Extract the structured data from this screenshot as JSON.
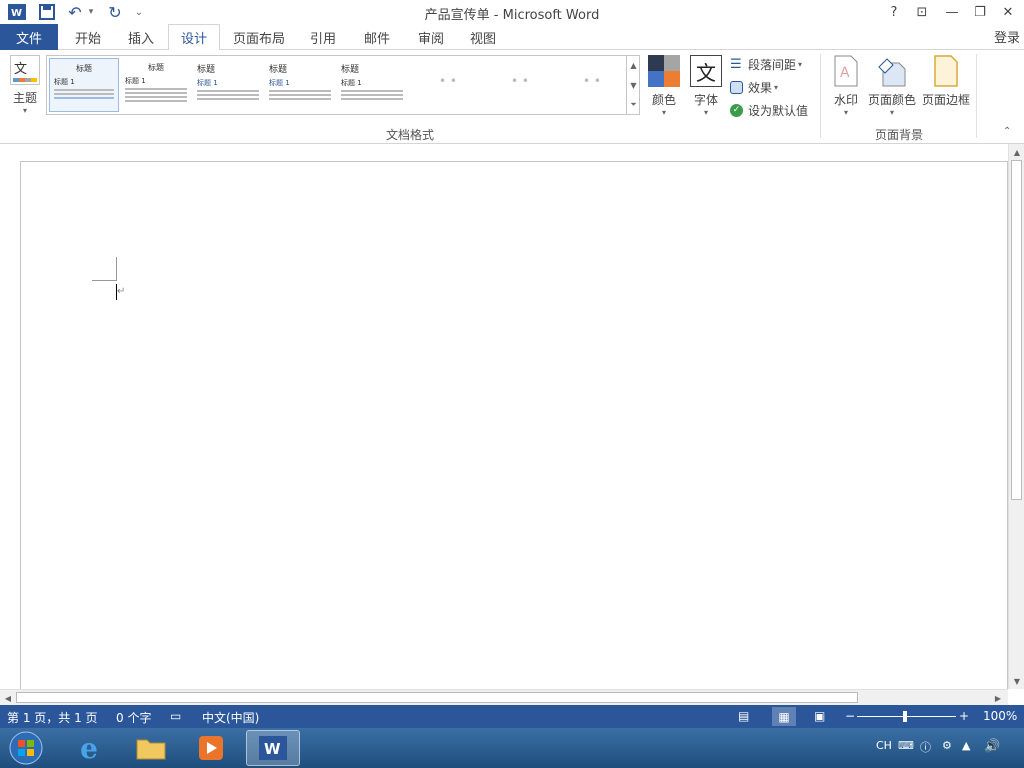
{
  "window": {
    "title": "产品宣传单 - Microsoft Word"
  },
  "quick_access": {
    "more_label": "⌄"
  },
  "window_controls": {
    "help": "?",
    "ribbon_options": "⊡",
    "minimize": "—",
    "restore": "❐",
    "close": "✕"
  },
  "tabs": [
    {
      "label": "文件"
    },
    {
      "label": "开始"
    },
    {
      "label": "插入"
    },
    {
      "label": "设计"
    },
    {
      "label": "页面布局"
    },
    {
      "label": "引用"
    },
    {
      "label": "邮件"
    },
    {
      "label": "审阅"
    },
    {
      "label": "视图"
    }
  ],
  "account": {
    "login": "登录"
  },
  "ribbon": {
    "theme_label": "主题",
    "theme_icon_text": "文",
    "gallery": [
      {
        "title": "标题",
        "heading": "标题 1"
      },
      {
        "title": "标题",
        "heading": "标题 1"
      },
      {
        "title": "标题",
        "heading": "标题 1"
      },
      {
        "title": "标题",
        "heading": "标题 1"
      },
      {
        "title": "标题",
        "heading": "标题 1"
      }
    ],
    "colors_label": "颜色",
    "fonts_label": "字体",
    "fonts_icon_text": "文",
    "paragraph_spacing_label": "段落间距",
    "effects_label": "效果",
    "set_default_label": "设为默认值",
    "document_format_group": "文档格式",
    "watermark_label": "水印",
    "page_color_label": "页面颜色",
    "page_borders_label": "页面边框",
    "page_background_group": "页面背景"
  },
  "status": {
    "page": "第 1 页，共 1 页",
    "words": "0 个字",
    "language": "中文(中国)",
    "zoom": "100%",
    "zoom_minus": "−",
    "zoom_plus": "+"
  },
  "tray": {
    "lang": "CH"
  },
  "colors": {
    "accent": "#2b579a"
  }
}
